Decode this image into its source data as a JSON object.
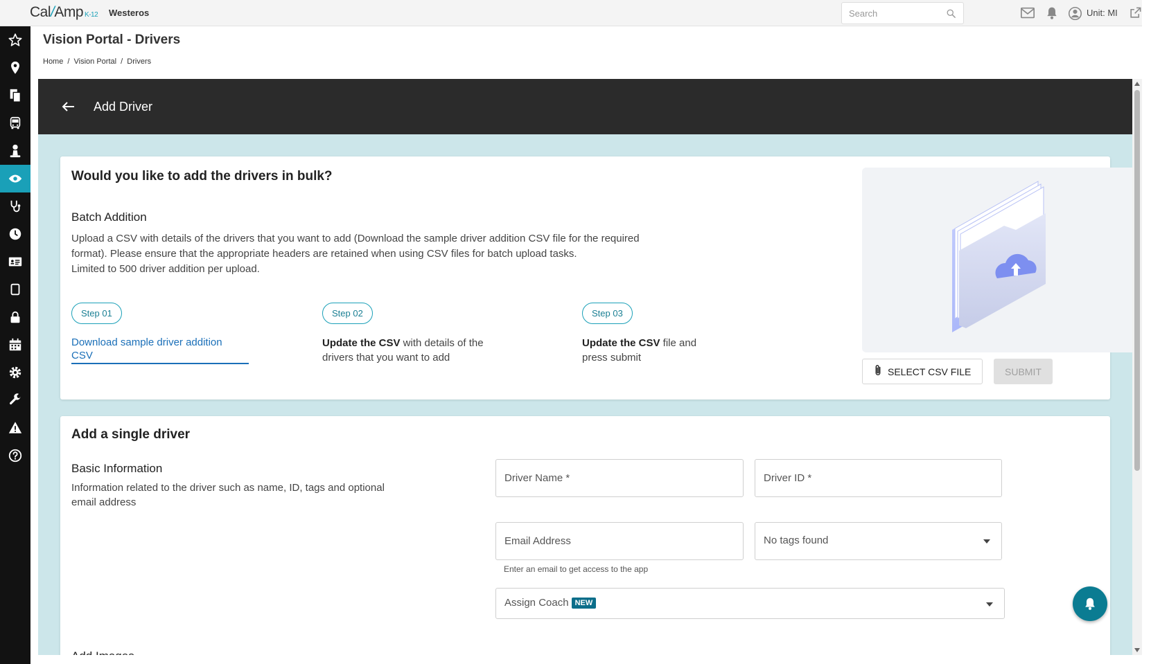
{
  "topbar": {
    "logo": {
      "part1": "Cal",
      "part2": "Amp",
      "suffix": "K-12"
    },
    "org_name": "Westeros",
    "search_placeholder": "Search",
    "unit_label": "Unit: MI"
  },
  "sidebar": {
    "items": [
      {
        "icon": "star-icon"
      },
      {
        "icon": "location-pin-icon"
      },
      {
        "icon": "documents-icon"
      },
      {
        "icon": "bus-icon"
      },
      {
        "icon": "driver-icon"
      },
      {
        "icon": "eye-icon",
        "active": true
      },
      {
        "icon": "stethoscope-icon"
      },
      {
        "icon": "clock-icon"
      },
      {
        "icon": "id-card-icon"
      },
      {
        "icon": "tablet-icon"
      },
      {
        "icon": "lock-icon"
      },
      {
        "icon": "calendar-icon"
      },
      {
        "icon": "gear-icon"
      },
      {
        "icon": "wrench-icon"
      },
      {
        "icon": "warning-icon"
      },
      {
        "icon": "help-icon"
      }
    ]
  },
  "page": {
    "title": "Vision Portal - Drivers",
    "breadcrumb": [
      "Home",
      "/",
      "Vision Portal",
      "/",
      "Drivers"
    ]
  },
  "header_bar": {
    "title": "Add Driver"
  },
  "bulk": {
    "heading": "Would you like to add the drivers in bulk?",
    "subheading": "Batch Addition",
    "description_line1": "Upload a CSV with details of the drivers that you want to add (Download the sample driver addition CSV file for the required",
    "description_line2": "format). Please ensure that the appropriate headers are retained when using CSV files for batch upload tasks.",
    "description_line3": "Limited to 500 driver addition per upload.",
    "steps": [
      {
        "label": "Step 01",
        "link_line1": "Download sample driver addition",
        "link_line2": "CSV"
      },
      {
        "label": "Step 02",
        "bold": "Update the CSV",
        "text1": " with details of the",
        "text2": "drivers that you want to add"
      },
      {
        "label": "Step 03",
        "bold": "Update the CSV",
        "text1": " file and",
        "text2": "press submit"
      }
    ],
    "select_button": "SELECT CSV FILE",
    "submit_button": "SUBMIT"
  },
  "single": {
    "heading": "Add a single driver",
    "basic_title": "Basic Information",
    "basic_desc_line1": "Information related to the driver such as name, ID, tags and optional",
    "basic_desc_line2": "email address",
    "driver_name_placeholder": "Driver Name *",
    "driver_id_placeholder": "Driver ID *",
    "email_placeholder": "Email Address",
    "email_helper": "Enter an email to get access to the app",
    "tags_placeholder": "No tags found",
    "coach_label": "Assign Coach",
    "coach_badge": "NEW",
    "images_title": "Add Images"
  },
  "colors": {
    "accent": "#1aa0b8",
    "dark_header": "#2b2b2b",
    "content_bg": "#cce6ea",
    "link": "#1a6fb8"
  }
}
